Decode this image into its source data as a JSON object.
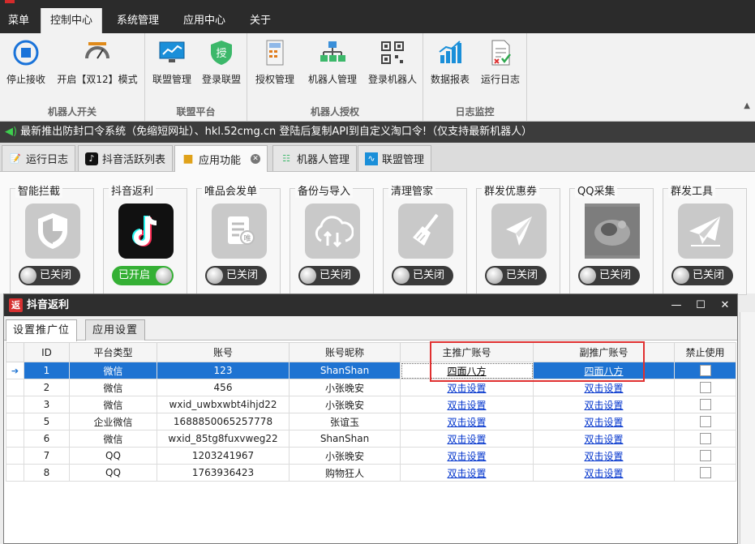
{
  "menu": [
    "菜单",
    "控制中心",
    "系统管理",
    "应用中心",
    "关于"
  ],
  "ribbon": {
    "groups": [
      {
        "label": "机器人开关",
        "buttons": [
          {
            "label": "停止接收",
            "icon": "stop-icon"
          },
          {
            "label": "开启【双12】模式",
            "icon": "gauge-icon"
          }
        ]
      },
      {
        "label": "联盟平台",
        "buttons": [
          {
            "label": "联盟管理",
            "icon": "monitor-chart-icon"
          },
          {
            "label": "登录联盟",
            "icon": "shield-auth-icon"
          }
        ]
      },
      {
        "label": "机器人授权",
        "buttons": [
          {
            "label": "授权管理",
            "icon": "calculator-icon"
          },
          {
            "label": "机器人管理",
            "icon": "network-icon"
          },
          {
            "label": "登录机器人",
            "icon": "qr-code-icon"
          }
        ]
      },
      {
        "label": "日志监控",
        "buttons": [
          {
            "label": "数据报表",
            "icon": "bar-chart-icon"
          },
          {
            "label": "运行日志",
            "icon": "log-doc-icon"
          }
        ]
      }
    ]
  },
  "ticker": "最新推出防封口令系统（免缩短网址）、hkl.52cmg.cn 登陆后复制API到自定义淘口令!（仅支持最新机器人）",
  "tabs": [
    "运行日志",
    "抖音活跃列表",
    "应用功能",
    "机器人管理",
    "联盟管理"
  ],
  "apps": [
    {
      "label": "智能拦截",
      "state": "已关闭",
      "on": false,
      "icon": "shield-icon"
    },
    {
      "label": "抖音返利",
      "state": "已开启",
      "on": true,
      "icon": "tiktok-icon"
    },
    {
      "label": "唯品会发单",
      "state": "已关闭",
      "on": false,
      "icon": "vip-doc-icon"
    },
    {
      "label": "备份与导入",
      "state": "已关闭",
      "on": false,
      "icon": "cloud-sync-icon"
    },
    {
      "label": "清理管家",
      "state": "已关闭",
      "on": false,
      "icon": "broom-icon"
    },
    {
      "label": "群发优惠券",
      "state": "已关闭",
      "on": false,
      "icon": "send-icon"
    },
    {
      "label": "QQ采集",
      "state": "已关闭",
      "on": false,
      "icon": "photo-icon"
    },
    {
      "label": "群发工具",
      "state": "已关闭",
      "on": false,
      "icon": "paper-plane-icon"
    }
  ],
  "dialog": {
    "title": "抖音返利",
    "icon_text": "返",
    "tabs": [
      "设置推广位",
      "应用设置"
    ],
    "columns": [
      "ID",
      "平台类型",
      "账号",
      "账号昵称",
      "主推广账号",
      "副推广账号",
      "禁止使用"
    ],
    "rows": [
      {
        "id": "1",
        "platform": "微信",
        "account": "123",
        "nick": "ShanShan",
        "main": "四面八方",
        "sub": "四面八方"
      },
      {
        "id": "2",
        "platform": "微信",
        "account": "456",
        "nick": "小张晚安",
        "main": "双击设置",
        "sub": "双击设置"
      },
      {
        "id": "3",
        "platform": "微信",
        "account": "wxid_uwbxwbt4ihjd22",
        "nick": "小张晚安",
        "main": "双击设置",
        "sub": "双击设置"
      },
      {
        "id": "5",
        "platform": "企业微信",
        "account": "1688850065257778",
        "nick": "张谊玉",
        "main": "双击设置",
        "sub": "双击设置"
      },
      {
        "id": "6",
        "platform": "微信",
        "account": "wxid_85tg8fuxvweg22",
        "nick": "ShanShan",
        "main": "双击设置",
        "sub": "双击设置"
      },
      {
        "id": "7",
        "platform": "QQ",
        "account": "1203241967",
        "nick": "小张晚安",
        "main": "双击设置",
        "sub": "双击设置"
      },
      {
        "id": "8",
        "platform": "QQ",
        "account": "1763936423",
        "nick": "购物狂人",
        "main": "双击设置",
        "sub": "双击设置"
      }
    ]
  }
}
